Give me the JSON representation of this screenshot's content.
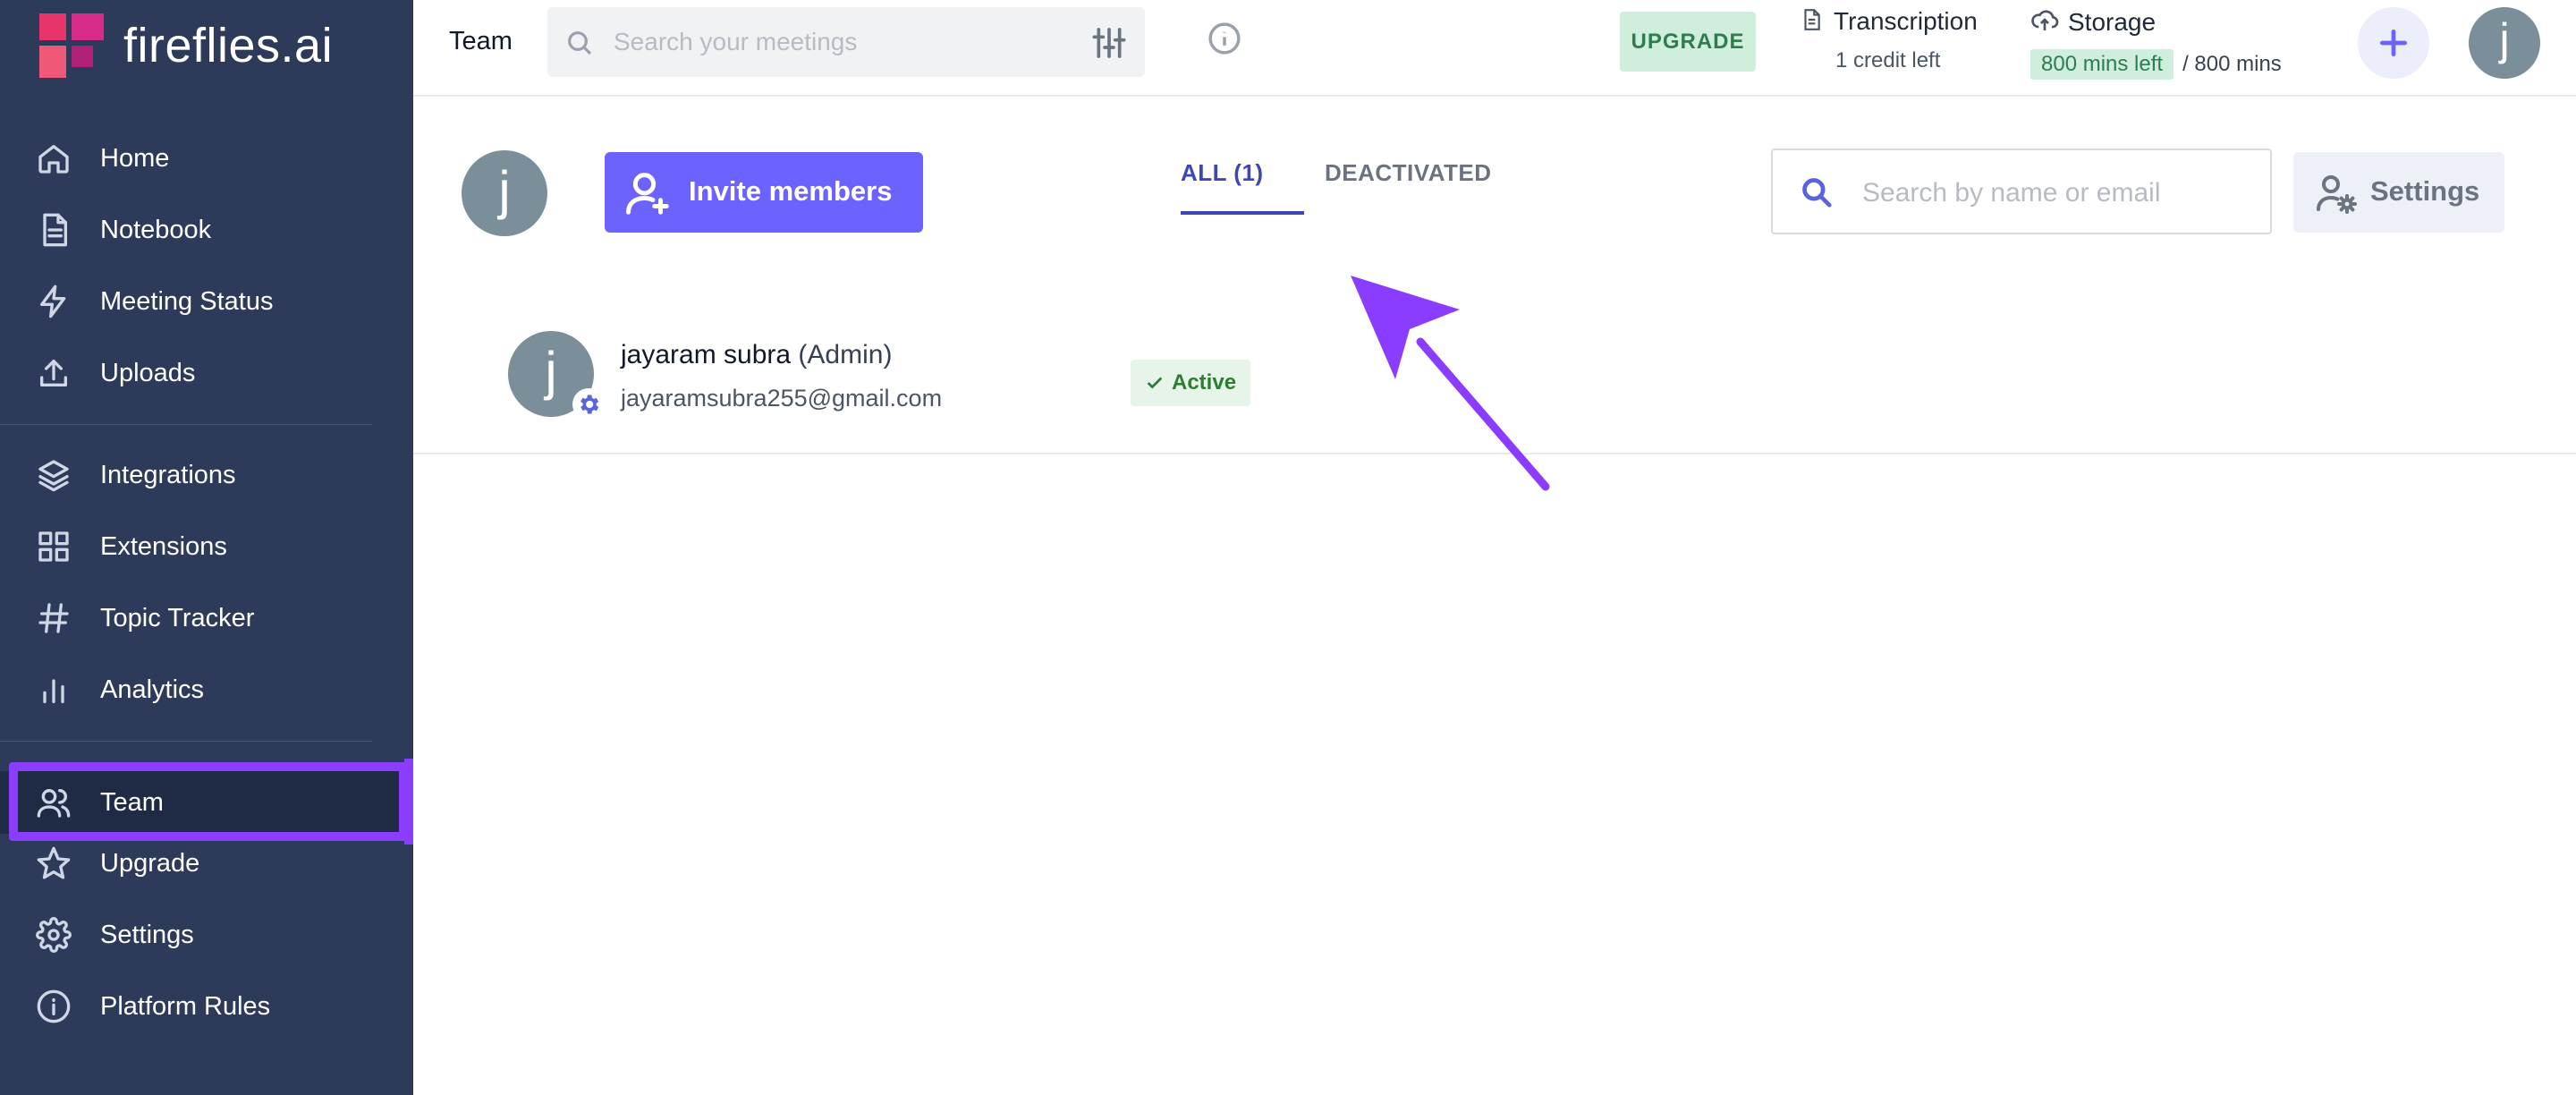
{
  "brand": {
    "name": "fireflies.ai"
  },
  "sidebar": {
    "items": [
      {
        "label": "Home",
        "icon": "home-icon"
      },
      {
        "label": "Notebook",
        "icon": "notebook-icon"
      },
      {
        "label": "Meeting Status",
        "icon": "lightning-icon"
      },
      {
        "label": "Uploads",
        "icon": "upload-icon"
      },
      {
        "label": "Integrations",
        "icon": "layers-icon"
      },
      {
        "label": "Extensions",
        "icon": "grid-icon"
      },
      {
        "label": "Topic Tracker",
        "icon": "hashtag-icon"
      },
      {
        "label": "Analytics",
        "icon": "bar-chart-icon"
      },
      {
        "label": "Team",
        "icon": "users-icon",
        "active": true
      },
      {
        "label": "Upgrade",
        "icon": "star-icon"
      },
      {
        "label": "Settings",
        "icon": "gear-icon"
      },
      {
        "label": "Platform Rules",
        "icon": "info-icon"
      }
    ]
  },
  "header": {
    "title": "Team",
    "search_placeholder": "Search your meetings",
    "upgrade_label": "UPGRADE",
    "transcription": {
      "title": "Transcription",
      "subtitle": "1 credit left"
    },
    "storage": {
      "title": "Storage",
      "badge": "800 mins left",
      "total": "/ 800 mins"
    },
    "avatar_initial": "j"
  },
  "team": {
    "avatar_initial": "j",
    "invite_label": "Invite members",
    "tabs": [
      {
        "label": "ALL (1)",
        "active": true
      },
      {
        "label": "DEACTIVATED",
        "active": false
      }
    ],
    "search_placeholder": "Search by name or email",
    "settings_label": "Settings",
    "members": [
      {
        "initial": "j",
        "name": "jayaram subra",
        "role": "(Admin)",
        "email": "jayaramsubra255@gmail.com",
        "status": "Active"
      }
    ]
  },
  "colors": {
    "sidebar_bg": "#2e3a59",
    "accent": "#6c63ff",
    "highlight": "#8b3dff",
    "success_bg": "#cfeedd",
    "success_text": "#2e7d4f"
  }
}
